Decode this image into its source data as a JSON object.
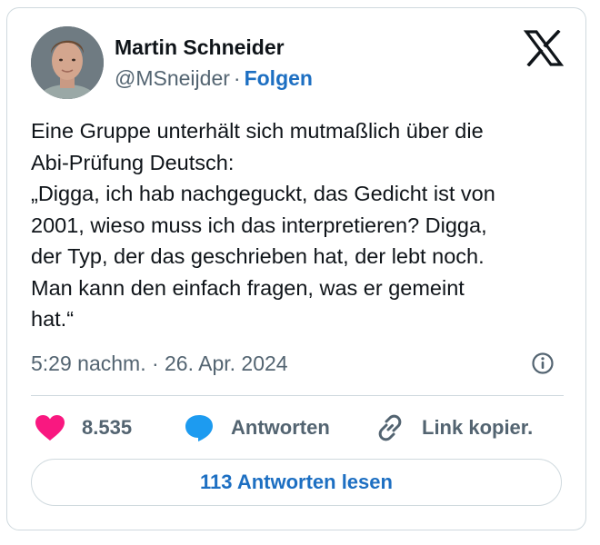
{
  "author": {
    "name": "Martin Schneider",
    "handle": "@MSneijder",
    "separator": "·",
    "follow_label": "Folgen"
  },
  "brand_icon": "x-logo-icon",
  "tweet": {
    "text": "Eine Gruppe unterhält sich mutmaßlich über die\nAbi-Prüfung Deutsch:\n„Digga, ich hab nachgeguckt, das Gedicht ist von\n2001, wieso muss ich das interpretieren? Digga,\nder Typ, der das geschrieben hat, der lebt noch.\nMan kann den einfach fragen, was er gemeint\nhat.“",
    "timestamp": "5:29 nachm. · 26. Apr. 2024"
  },
  "actions": {
    "likes": "8.535",
    "reply_label": "Antworten",
    "copy_link_label": "Link kopier."
  },
  "read_replies_label": "113 Antworten lesen",
  "colors": {
    "accent": "#1d6fc2",
    "heart": "#f91880",
    "reply_bubble": "#1d9bf0",
    "muted_text": "#536471",
    "border": "#cfd9de"
  }
}
